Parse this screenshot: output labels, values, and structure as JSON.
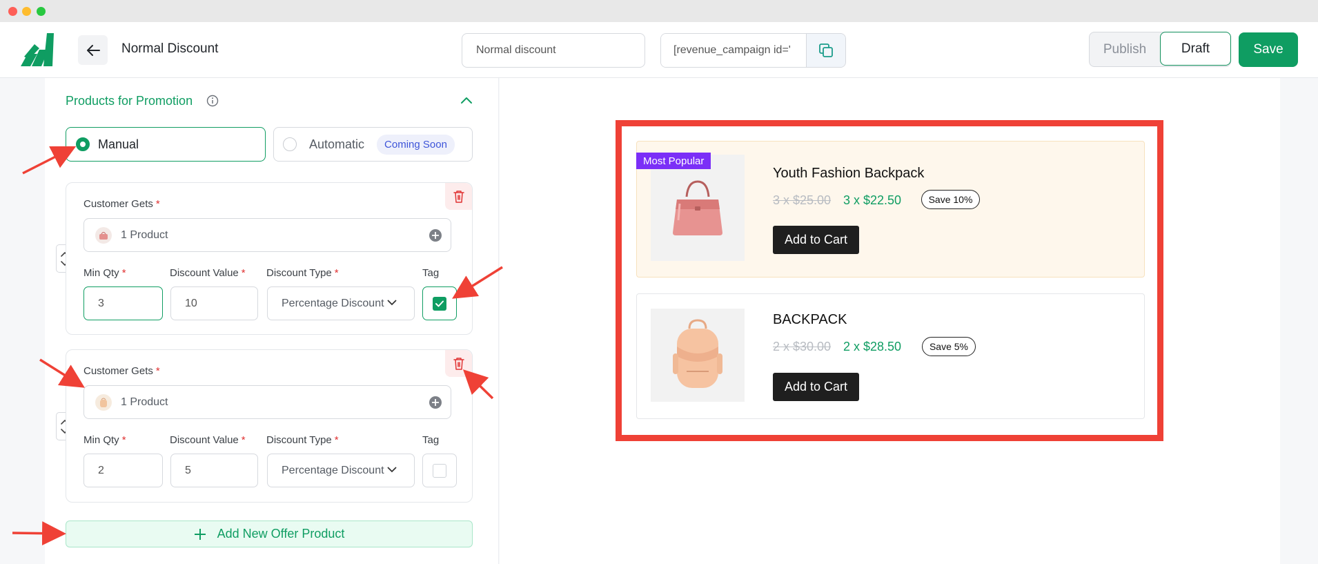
{
  "header": {
    "title": "Normal Discount",
    "name_value": "Normal discount",
    "shortcode_value": "[revenue_campaign id='",
    "publish_label": "Publish",
    "draft_label": "Draft",
    "save_label": "Save"
  },
  "section": {
    "title": "Products for Promotion",
    "mode_manual": "Manual",
    "mode_automatic": "Automatic",
    "coming_soon": "Coming Soon"
  },
  "offers": [
    {
      "customer_gets_label": "Customer Gets",
      "product_text": "1 Product",
      "min_qty_label": "Min Qty",
      "discount_value_label": "Discount Value",
      "discount_type_label": "Discount Type",
      "tag_label": "Tag",
      "min_qty": "3",
      "discount_value": "10",
      "discount_type": "Percentage Discount",
      "tag_checked": true
    },
    {
      "customer_gets_label": "Customer Gets",
      "product_text": "1 Product",
      "min_qty_label": "Min Qty",
      "discount_value_label": "Discount Value",
      "discount_type_label": "Discount Type",
      "tag_label": "Tag",
      "min_qty": "2",
      "discount_value": "5",
      "discount_type": "Percentage Discount",
      "tag_checked": false
    }
  ],
  "add_offer_label": "Add New Offer Product",
  "preview": {
    "products": [
      {
        "badge": "Most Popular",
        "name": "Youth Fashion Backpack",
        "old_price": "3 x $25.00",
        "new_price": "3 x $22.50",
        "save": "Save 10%",
        "cta": "Add to Cart"
      },
      {
        "name": "BACKPACK",
        "old_price": "2 x $30.00",
        "new_price": "2 x $28.50",
        "save": "Save 5%",
        "cta": "Add to Cart"
      }
    ]
  },
  "colors": {
    "brand_green": "#0f9d62",
    "annotation_red": "#ef4136",
    "badge_purple": "#7b2ff7"
  }
}
